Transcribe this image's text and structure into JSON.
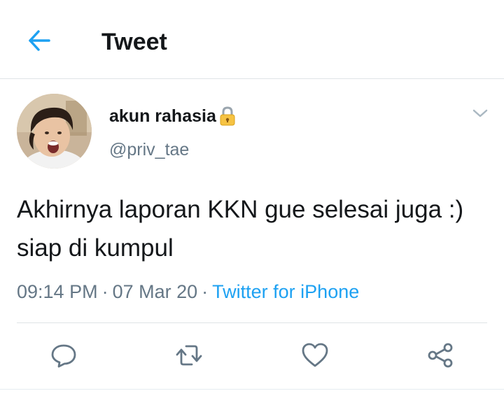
{
  "header": {
    "title": "Tweet",
    "back_icon": "arrow-left-icon",
    "accent_color": "#1da1f2"
  },
  "tweet": {
    "display_name": "akun rahasia",
    "name_emoji": "lock-emoji",
    "username": "@priv_tae",
    "text": "Akhirnya laporan KKN gue selesai juga :) siap di kumpul",
    "time": "09:14 PM",
    "date": "07 Mar 20",
    "separator": "·",
    "source": "Twitter for iPhone"
  },
  "actions": [
    {
      "name": "reply",
      "icon": "reply-icon"
    },
    {
      "name": "retweet",
      "icon": "retweet-icon"
    },
    {
      "name": "like",
      "icon": "heart-icon"
    },
    {
      "name": "share",
      "icon": "share-icon"
    }
  ],
  "colors": {
    "text_primary": "#14171a",
    "text_secondary": "#657786",
    "link": "#1da1f2",
    "border": "#dfe3e6"
  }
}
